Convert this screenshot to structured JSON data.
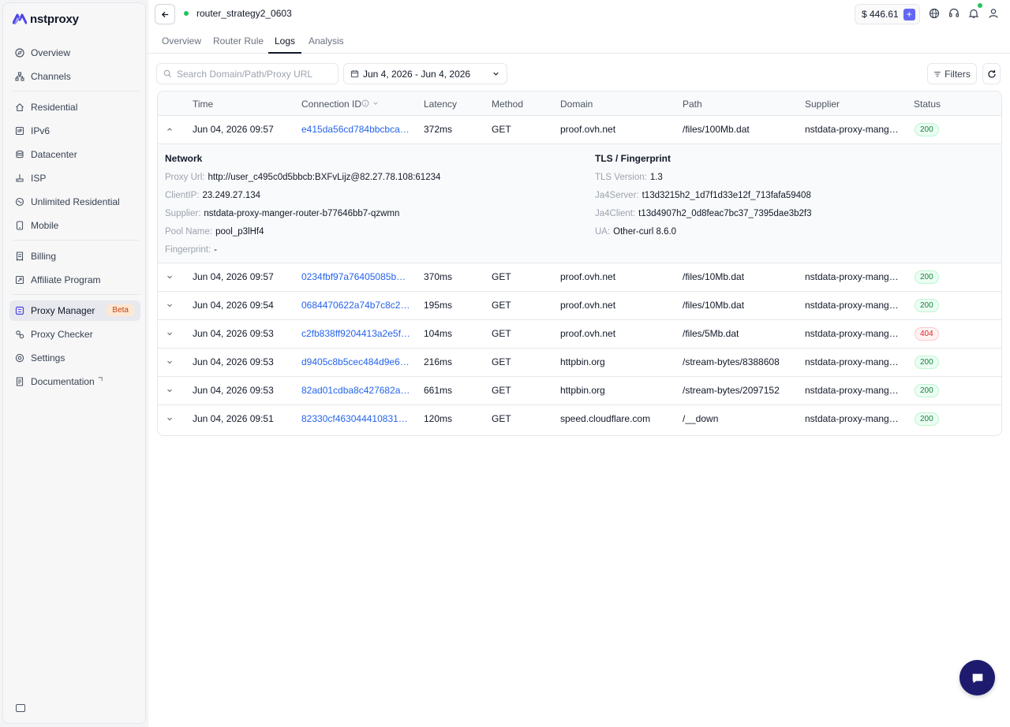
{
  "brand": {
    "name": "nstproxy"
  },
  "sidebar": {
    "items": [
      {
        "label": "Overview",
        "icon": "compass-icon"
      },
      {
        "label": "Channels",
        "icon": "sitemap-icon"
      },
      {
        "label": "Residential",
        "icon": "home-icon"
      },
      {
        "label": "IPv6",
        "icon": "ipv6-icon"
      },
      {
        "label": "Datacenter",
        "icon": "database-icon"
      },
      {
        "label": "ISP",
        "icon": "server-icon"
      },
      {
        "label": "Unlimited Residential",
        "icon": "infinity-icon"
      },
      {
        "label": "Mobile",
        "icon": "phone-icon"
      },
      {
        "label": "Billing",
        "icon": "receipt-icon"
      },
      {
        "label": "Affiliate Program",
        "icon": "share-icon"
      },
      {
        "label": "Proxy Manager",
        "icon": "proxy-manager-icon",
        "badge": "Beta"
      },
      {
        "label": "Proxy Checker",
        "icon": "checker-icon"
      },
      {
        "label": "Settings",
        "icon": "gear-icon"
      },
      {
        "label": "Documentation",
        "icon": "document-icon"
      }
    ]
  },
  "header": {
    "title": "router_strategy2_0603",
    "balance": "$ 446.61",
    "plus": "+"
  },
  "tabs": [
    {
      "label": "Overview"
    },
    {
      "label": "Router Rule"
    },
    {
      "label": "Logs"
    },
    {
      "label": "Analysis"
    }
  ],
  "toolbar": {
    "search_placeholder": "Search Domain/Path/Proxy URL",
    "date_range": "Jun 4, 2026 - Jun 4, 2026",
    "filters_label": "Filters"
  },
  "table": {
    "columns": [
      "Time",
      "Connection ID",
      "Latency",
      "Method",
      "Domain",
      "Path",
      "Supplier",
      "Status"
    ],
    "rows": [
      {
        "time": "Jun 04, 2026 09:57",
        "id": "e415da56cd784bbcbca8…",
        "latency": "372ms",
        "method": "GET",
        "domain": "proof.ovh.net",
        "path": "/files/100Mb.dat",
        "supplier": "nstdata-proxy-mange…",
        "status": "200"
      },
      {
        "time": "Jun 04, 2026 09:57",
        "id": "0234fbf97a76405085b…",
        "latency": "370ms",
        "method": "GET",
        "domain": "proof.ovh.net",
        "path": "/files/10Mb.dat",
        "supplier": "nstdata-proxy-mange…",
        "status": "200"
      },
      {
        "time": "Jun 04, 2026 09:54",
        "id": "0684470622a74b7c8c2…",
        "latency": "195ms",
        "method": "GET",
        "domain": "proof.ovh.net",
        "path": "/files/10Mb.dat",
        "supplier": "nstdata-proxy-mange…",
        "status": "200"
      },
      {
        "time": "Jun 04, 2026 09:53",
        "id": "c2fb838ff9204413a2e5f…",
        "latency": "104ms",
        "method": "GET",
        "domain": "proof.ovh.net",
        "path": "/files/5Mb.dat",
        "supplier": "nstdata-proxy-mange…",
        "status": "404"
      },
      {
        "time": "Jun 04, 2026 09:53",
        "id": "d9405c8b5cec484d9e6…",
        "latency": "216ms",
        "method": "GET",
        "domain": "httpbin.org",
        "path": "/stream-bytes/8388608",
        "supplier": "nstdata-proxy-mange…",
        "status": "200"
      },
      {
        "time": "Jun 04, 2026 09:53",
        "id": "82ad01cdba8c427682ac…",
        "latency": "661ms",
        "method": "GET",
        "domain": "httpbin.org",
        "path": "/stream-bytes/2097152",
        "supplier": "nstdata-proxy-mange…",
        "status": "200"
      },
      {
        "time": "Jun 04, 2026 09:51",
        "id": "82330cf463044410831…",
        "latency": "120ms",
        "method": "GET",
        "domain": "speed.cloudflare.com",
        "path": "/__down",
        "supplier": "nstdata-proxy-mange…",
        "status": "200"
      }
    ]
  },
  "details": {
    "network_title": "Network",
    "network": [
      {
        "key": "Proxy Url:",
        "value": "http://user_c495c0d5bbcb:BXFvLijz@82.27.78.108:61234"
      },
      {
        "key": "ClientIP:",
        "value": "23.249.27.134"
      },
      {
        "key": "Supplier:",
        "value": "nstdata-proxy-manger-router-b77646bb7-qzwmn"
      },
      {
        "key": "Pool Name:",
        "value": "pool_p3lHf4"
      },
      {
        "key": "Fingerprint:",
        "value": "-"
      }
    ],
    "tls_title": "TLS / Fingerprint",
    "tls": [
      {
        "key": "TLS Version:",
        "value": "1.3"
      },
      {
        "key": "Ja4Server:",
        "value": "t13d3215h2_1d7f1d33e12f_713fafa59408"
      },
      {
        "key": "Ja4Client:",
        "value": "t13d4907h2_0d8feac7bc37_7395dae3b2f3"
      },
      {
        "key": "UA:",
        "value": "Other-curl 8.6.0"
      }
    ]
  },
  "colors": {
    "accent": "#2563eb",
    "success": "#15803d",
    "error": "#dc2626",
    "brand": "#1e1b6f"
  }
}
